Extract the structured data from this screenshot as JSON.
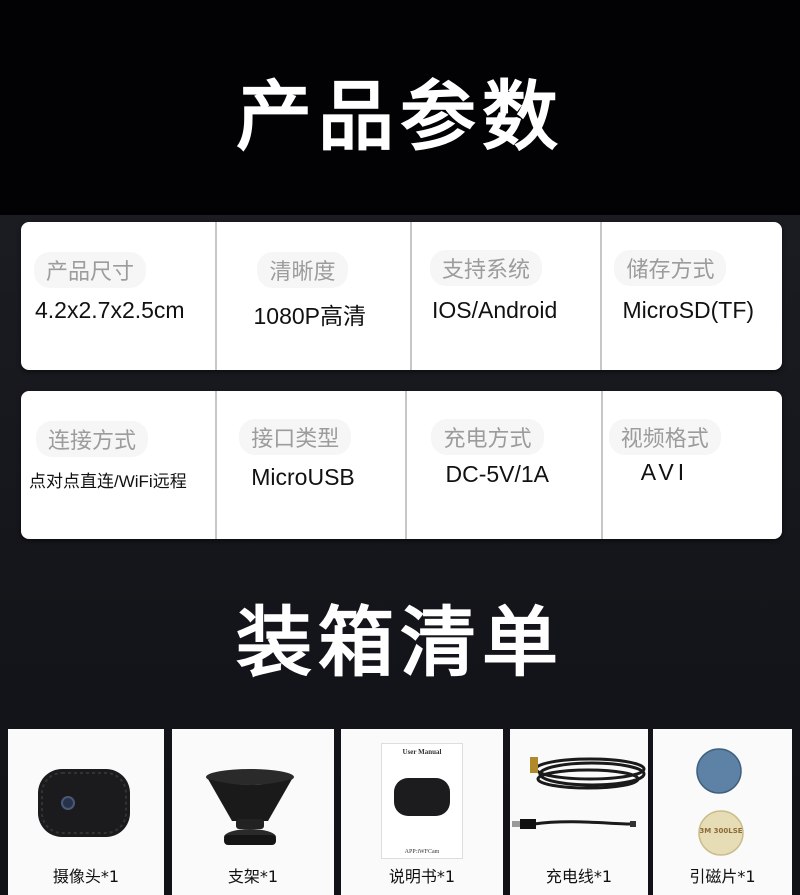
{
  "section1_title": "产品参数",
  "section2_title": "装箱清单",
  "specs_row1": [
    {
      "label": "产品尺寸",
      "value": "4.2x2.7x2.5cm"
    },
    {
      "label": "清晰度",
      "value": "1080P高清"
    },
    {
      "label": "支持系统",
      "value": "IOS/Android"
    },
    {
      "label": "储存方式",
      "value": "MicroSD(TF)"
    }
  ],
  "specs_row2": [
    {
      "label": "连接方式",
      "value": "点对点直连/WiFi远程"
    },
    {
      "label": "接口类型",
      "value": "MicroUSB"
    },
    {
      "label": "充电方式",
      "value": "DC-5V/1A"
    },
    {
      "label": "视频格式",
      "value": "AVI"
    }
  ],
  "package": [
    {
      "caption": "摄像头*1",
      "icon": "camera-icon"
    },
    {
      "caption": "支架*1",
      "icon": "stand-icon"
    },
    {
      "caption": "说明书*1",
      "icon": "manual-icon",
      "manual_title": "User Manual",
      "manual_footer": "APP:iWFCam"
    },
    {
      "caption": "充电线*1",
      "icon": "cable-icon"
    },
    {
      "caption": "引磁片*1",
      "icon": "magnet-plate-icon",
      "sticker_text": "3M 300LSE"
    }
  ],
  "colors": {
    "background_top": "#020204",
    "background_mid": "#1a1c22",
    "card": "#ffffff",
    "label": "#9c9c9c"
  }
}
